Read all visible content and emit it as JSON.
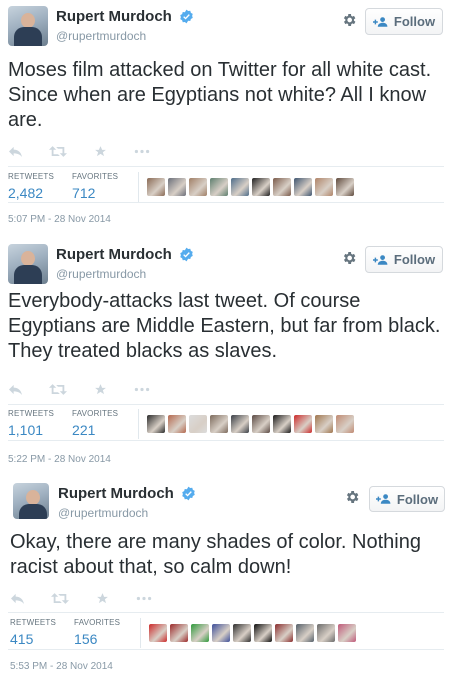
{
  "tweets": [
    {
      "author": {
        "name": "Rupert Murdoch",
        "handle": "@rupertmurdoch"
      },
      "follow_label": "Follow",
      "text": "Moses film attacked on Twitter for all white cast. Since when are Egyptians not white? All I know are.",
      "stats": {
        "retweets_label": "RETWEETS",
        "retweets": "2,482",
        "favorites_label": "FAVORITES",
        "favorites": "712"
      },
      "favoriter_avatars": [
        "#8a6a55",
        "#6b6f7a",
        "#a07f66",
        "#5e7f6f",
        "#4e6d8a",
        "#1f1f1f",
        "#7a5a4a",
        "#3e5570",
        "#b08468",
        "#5f4a3d"
      ],
      "timestamp": "5:07 PM - 28 Nov 2014"
    },
    {
      "author": {
        "name": "Rupert Murdoch",
        "handle": "@rupertmurdoch"
      },
      "follow_label": "Follow",
      "text": "Everybody-attacks last tweet.  Of course Egyptians are Middle Eastern, but far from black. They treated blacks as slaves.",
      "stats": {
        "retweets_label": "RETWEETS",
        "retweets": "1,101",
        "favorites_label": "FAVORITES",
        "favorites": "221"
      },
      "favoriter_avatars": [
        "#2b2b2b",
        "#b5694f",
        "#dcdcdc",
        "#7c6a5c",
        "#3a3f46",
        "#5b4a44",
        "#1a1a1a",
        "#cc2a2a",
        "#a0764e",
        "#c08a72"
      ],
      "timestamp": "5:22 PM - 28 Nov 2014"
    },
    {
      "author": {
        "name": "Rupert Murdoch",
        "handle": "@rupertmurdoch"
      },
      "follow_label": "Follow",
      "text": "Okay, there are many shades of color. Nothing racist about that, so calm down!",
      "stats": {
        "retweets_label": "RETWEETS",
        "retweets": "415",
        "favorites_label": "FAVORITES",
        "favorites": "156"
      },
      "favoriter_avatars": [
        "#cc2a2a",
        "#9c2a2a",
        "#2f9a3c",
        "#3d4f9a",
        "#2e2e2e",
        "#0d0d0d",
        "#8a2d2d",
        "#55606a",
        "#6b6b6b",
        "#c05a7a"
      ],
      "timestamp": "5:53 PM - 28 Nov 2014"
    }
  ],
  "icons": [
    "verified-badge-icon",
    "gear-icon",
    "add-user-icon",
    "reply-icon",
    "retweet-icon",
    "favorite-star-icon",
    "more-icon"
  ],
  "colors": {
    "link_blue": "#3b88c3",
    "verified_blue": "#55acee",
    "muted_text": "#8899a6"
  }
}
